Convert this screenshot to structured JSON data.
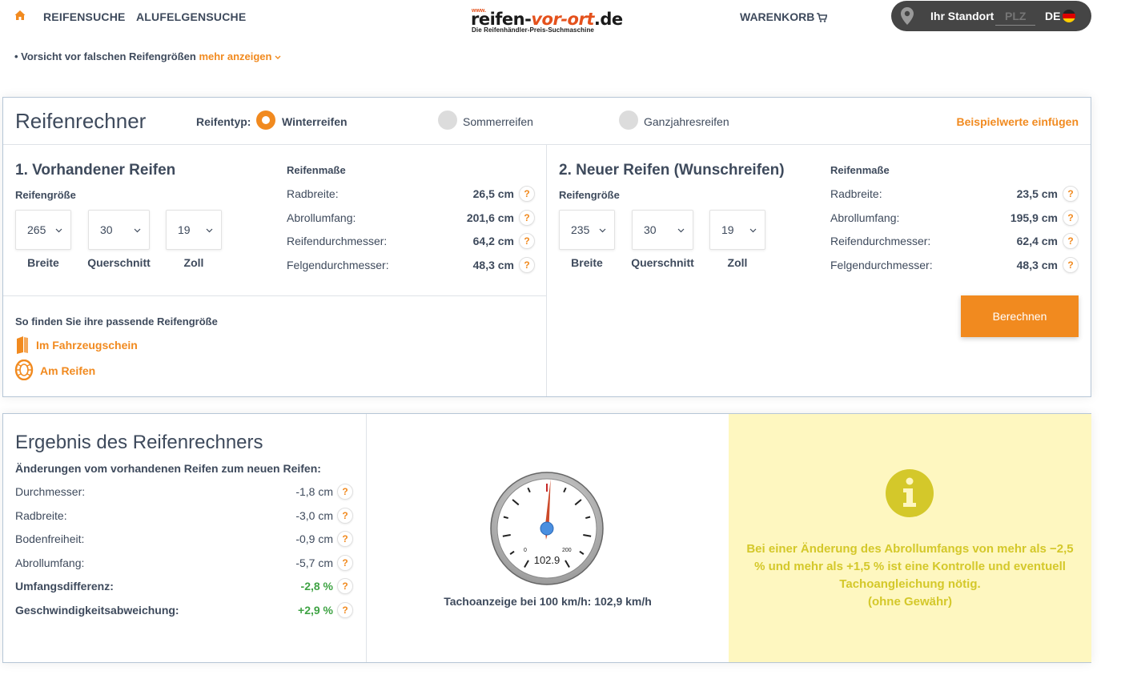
{
  "header": {
    "home_icon": "home-icon",
    "nav": [
      "REIFENSUCHE",
      "ALUFELGENSUCHE"
    ],
    "logo": {
      "www": "www.",
      "main_a": "reifen-",
      "main_b": "vor-ort",
      "main_c": ".de",
      "tagline": "Die Reifenhändler-Preis-Suchmaschine"
    },
    "cart": "WARENKORB",
    "location_label": "Ihr Standort",
    "plz_placeholder": "PLZ",
    "country": "DE",
    "accent": "#f18a1f"
  },
  "warning": {
    "text": "• Vorsicht vor falschen Reifengrößen",
    "more": "mehr anzeigen"
  },
  "calculator": {
    "title": "Reifenrechner",
    "tire_type_label": "Reifentyp:",
    "types": [
      "Winterreifen",
      "Sommerreifen",
      "Ganzjahresreifen"
    ],
    "selected_type": "Winterreifen",
    "example_values": "Beispielwerte einfügen",
    "current": {
      "heading": "1. Vorhandener Reifen",
      "size_label": "Reifengröße",
      "width": "265",
      "ratio": "30",
      "rim": "19",
      "cap_width": "Breite",
      "cap_ratio": "Querschnitt",
      "cap_rim": "Zoll",
      "dims_heading": "Reifenmaße",
      "rows": [
        {
          "label": "Radbreite:",
          "value": "26,5 cm"
        },
        {
          "label": "Abrollumfang:",
          "value": "201,6 cm"
        },
        {
          "label": "Reifendurchmesser:",
          "value": "64,2 cm"
        },
        {
          "label": "Felgendurchmesser:",
          "value": "48,3 cm"
        }
      ]
    },
    "new": {
      "heading": "2. Neuer Reifen (Wunschreifen)",
      "size_label": "Reifengröße",
      "width": "235",
      "ratio": "30",
      "rim": "19",
      "cap_width": "Breite",
      "cap_ratio": "Querschnitt",
      "cap_rim": "Zoll",
      "dims_heading": "Reifenmaße",
      "rows": [
        {
          "label": "Radbreite:",
          "value": "23,5 cm"
        },
        {
          "label": "Abrollumfang:",
          "value": "195,9 cm"
        },
        {
          "label": "Reifendurchmesser:",
          "value": "62,4 cm"
        },
        {
          "label": "Felgendurchmesser:",
          "value": "48,3 cm"
        }
      ]
    },
    "help": {
      "heading": "So finden Sie ihre passende Reifengröße",
      "link1": "Im Fahrzeugschein",
      "link2": "Am Reifen"
    },
    "calculate": "Berechnen"
  },
  "result": {
    "title": "Ergebnis des Reifenrechners",
    "subtitle": "Änderungen vom vorhandenen Reifen zum neuen Reifen:",
    "rows": [
      {
        "label": "Durchmesser:",
        "value": "-1,8 cm"
      },
      {
        "label": "Radbreite:",
        "value": "-3,0 cm"
      },
      {
        "label": "Bodenfreiheit:",
        "value": "-0,9 cm"
      },
      {
        "label": "Abrollumfang:",
        "value": "-5,7 cm"
      },
      {
        "label": "Umfangsdifferenz:",
        "value": "-2,8 %"
      },
      {
        "label": "Geschwindigkeitsabweichung:",
        "value": "+2,9 %"
      }
    ],
    "speedo": {
      "min_label": "0",
      "max_label": "200",
      "reading": "102.9",
      "value": 102.9
    },
    "speedo_caption": "Tachoanzeige bei 100 km/h: 102,9 km/h",
    "info_text_1": "Bei einer Änderung des Abrollumfangs von mehr als −2,5 % und mehr als +1,5 % ist eine Kontrolle und eventuell Tachoangleichung nötig.",
    "info_text_2": "(ohne Gewähr)",
    "info_color": "#d4c82a"
  }
}
